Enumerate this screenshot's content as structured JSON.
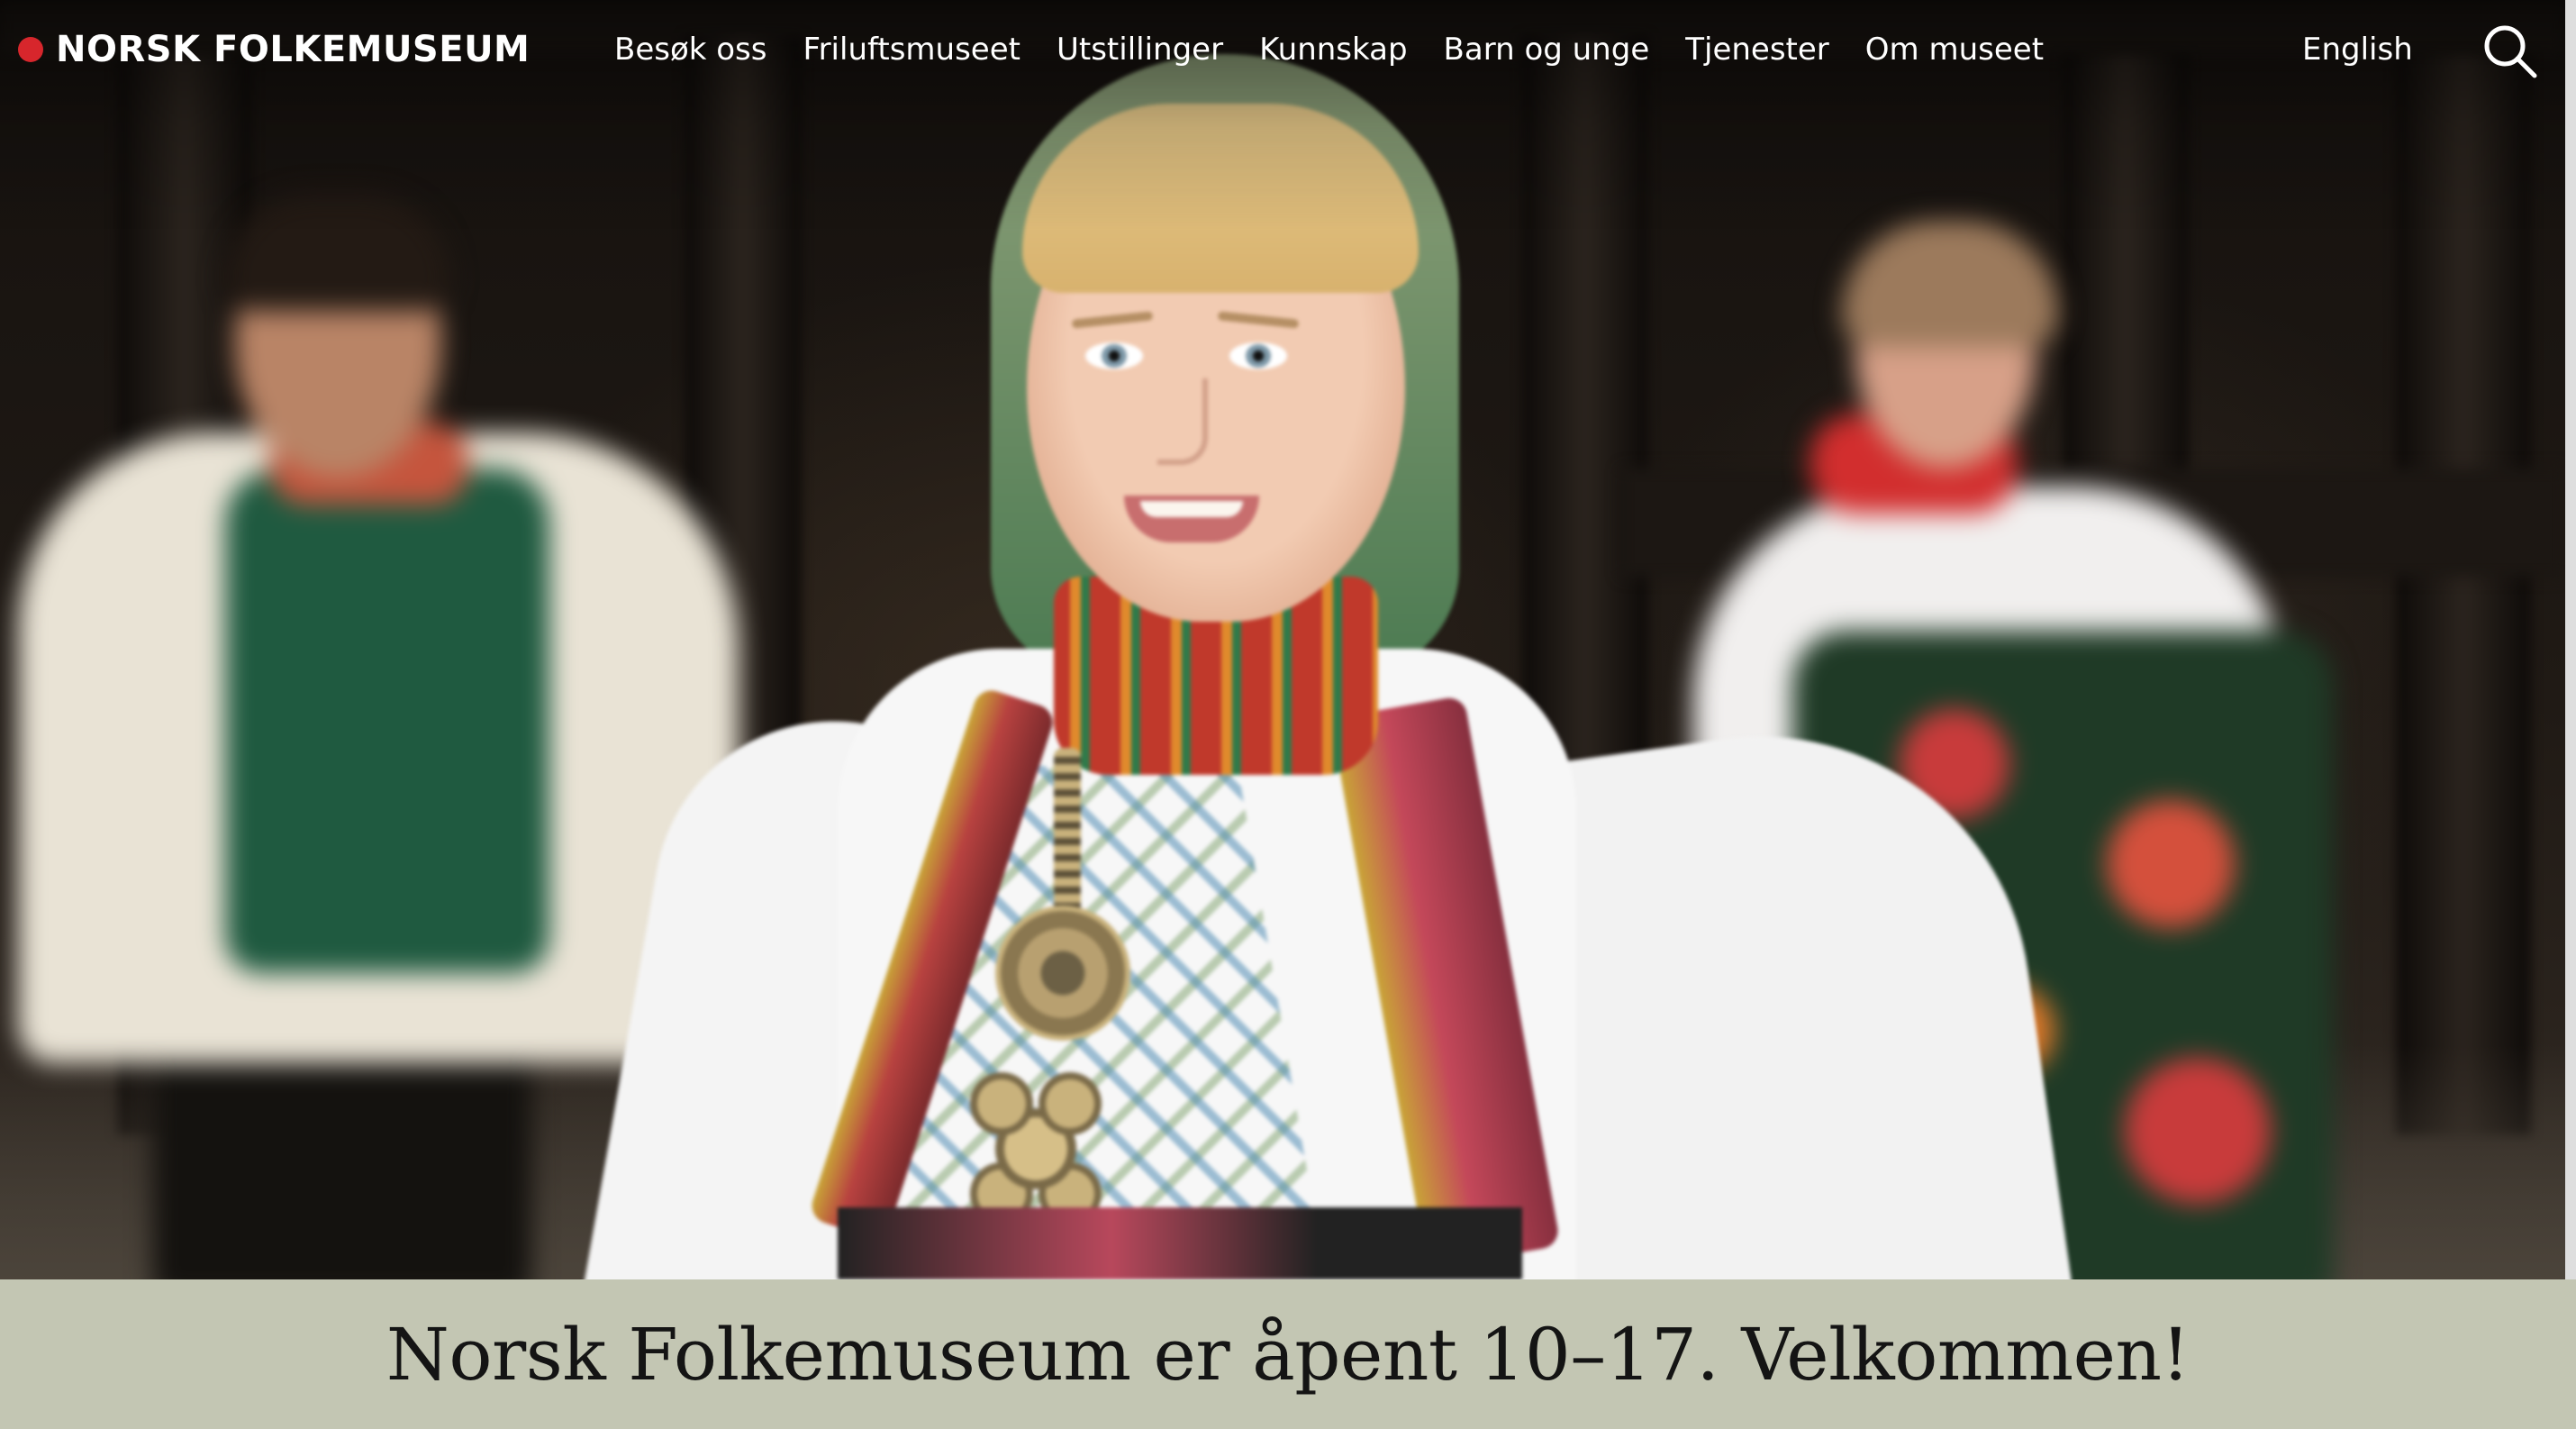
{
  "header": {
    "logo_text": "NORSK FOLKEMUSEUM",
    "nav": [
      {
        "label": "Besøk oss"
      },
      {
        "label": "Friluftsmuseet"
      },
      {
        "label": "Utstillinger"
      },
      {
        "label": "Kunnskap"
      },
      {
        "label": "Barn og unge"
      },
      {
        "label": "Tjenester"
      },
      {
        "label": "Om museet"
      }
    ],
    "language_link": "English",
    "search_icon": "search-icon"
  },
  "hero": {
    "image": "folk-costume-dancers-photo"
  },
  "banner": {
    "text": "Norsk Folkemuseum er åpent 10–17. Velkommen!"
  },
  "colors": {
    "logo_dot": "#d7262c",
    "banner_background": "#c3c6b3",
    "nav_text": "#ffffff",
    "banner_text": "#141414"
  }
}
